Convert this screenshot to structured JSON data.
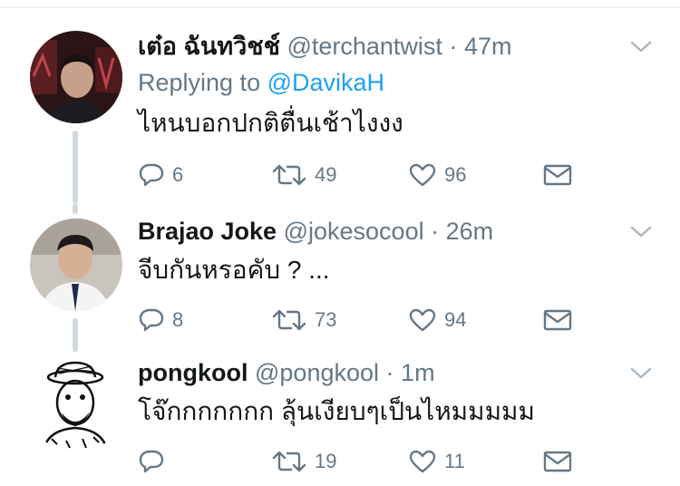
{
  "tweets": [
    {
      "name": "เต๋อ ฉันทวิชช์",
      "handle": "@terchantwist",
      "separator": "·",
      "time": "47m",
      "replying_prefix": "Replying to",
      "replying_to": "@DavikaH",
      "text": "ไหนบอกปกติตื่นเช้าไงงง",
      "replies": "6",
      "retweets": "49",
      "likes": "96"
    },
    {
      "name": "Brajao Joke",
      "handle": "@jokesocool",
      "separator": "·",
      "time": "26m",
      "text": "จีบกันหรอคับ ? ...",
      "replies": "8",
      "retweets": "73",
      "likes": "94"
    },
    {
      "name": "pongkool",
      "handle": "@pongkool",
      "separator": "·",
      "time": "1m",
      "text": "โจ๊กกกกกกก ลุ้นเงียบๆเป็นไหมมมมม",
      "replies": "",
      "retweets": "19",
      "likes": "11"
    }
  ],
  "icons": {
    "reply": "reply-icon",
    "retweet": "retweet-icon",
    "like": "heart-icon",
    "dm": "envelope-icon",
    "caret": "chevron-down-icon"
  },
  "colors": {
    "text": "#14171a",
    "secondary": "#657786",
    "link": "#1da1f2",
    "thread_line": "#cfd9de"
  }
}
